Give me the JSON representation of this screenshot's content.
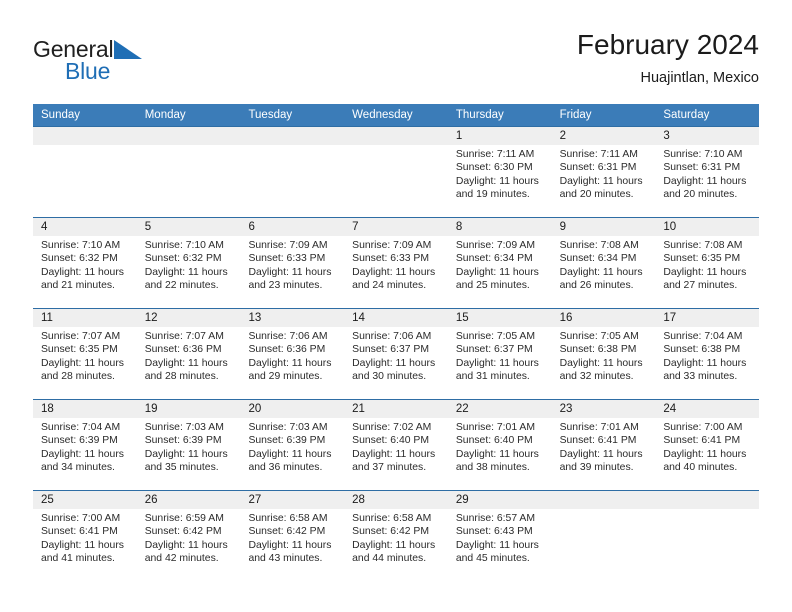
{
  "brand": {
    "name_part1": "General",
    "name_part2": "Blue",
    "logo_icon": "triangle-logo-icon",
    "accent_color": "#1f6eb5"
  },
  "header": {
    "title": "February 2024",
    "subtitle": "Huajintlan, Mexico"
  },
  "calendar": {
    "header_bg": "#3b7cb8",
    "weekdays": [
      "Sunday",
      "Monday",
      "Tuesday",
      "Wednesday",
      "Thursday",
      "Friday",
      "Saturday"
    ],
    "weeks": [
      [
        {
          "day": ""
        },
        {
          "day": ""
        },
        {
          "day": ""
        },
        {
          "day": ""
        },
        {
          "day": "1",
          "sunrise": "Sunrise: 7:11 AM",
          "sunset": "Sunset: 6:30 PM",
          "daylight": "Daylight: 11 hours and 19 minutes."
        },
        {
          "day": "2",
          "sunrise": "Sunrise: 7:11 AM",
          "sunset": "Sunset: 6:31 PM",
          "daylight": "Daylight: 11 hours and 20 minutes."
        },
        {
          "day": "3",
          "sunrise": "Sunrise: 7:10 AM",
          "sunset": "Sunset: 6:31 PM",
          "daylight": "Daylight: 11 hours and 20 minutes."
        }
      ],
      [
        {
          "day": "4",
          "sunrise": "Sunrise: 7:10 AM",
          "sunset": "Sunset: 6:32 PM",
          "daylight": "Daylight: 11 hours and 21 minutes."
        },
        {
          "day": "5",
          "sunrise": "Sunrise: 7:10 AM",
          "sunset": "Sunset: 6:32 PM",
          "daylight": "Daylight: 11 hours and 22 minutes."
        },
        {
          "day": "6",
          "sunrise": "Sunrise: 7:09 AM",
          "sunset": "Sunset: 6:33 PM",
          "daylight": "Daylight: 11 hours and 23 minutes."
        },
        {
          "day": "7",
          "sunrise": "Sunrise: 7:09 AM",
          "sunset": "Sunset: 6:33 PM",
          "daylight": "Daylight: 11 hours and 24 minutes."
        },
        {
          "day": "8",
          "sunrise": "Sunrise: 7:09 AM",
          "sunset": "Sunset: 6:34 PM",
          "daylight": "Daylight: 11 hours and 25 minutes."
        },
        {
          "day": "9",
          "sunrise": "Sunrise: 7:08 AM",
          "sunset": "Sunset: 6:34 PM",
          "daylight": "Daylight: 11 hours and 26 minutes."
        },
        {
          "day": "10",
          "sunrise": "Sunrise: 7:08 AM",
          "sunset": "Sunset: 6:35 PM",
          "daylight": "Daylight: 11 hours and 27 minutes."
        }
      ],
      [
        {
          "day": "11",
          "sunrise": "Sunrise: 7:07 AM",
          "sunset": "Sunset: 6:35 PM",
          "daylight": "Daylight: 11 hours and 28 minutes."
        },
        {
          "day": "12",
          "sunrise": "Sunrise: 7:07 AM",
          "sunset": "Sunset: 6:36 PM",
          "daylight": "Daylight: 11 hours and 28 minutes."
        },
        {
          "day": "13",
          "sunrise": "Sunrise: 7:06 AM",
          "sunset": "Sunset: 6:36 PM",
          "daylight": "Daylight: 11 hours and 29 minutes."
        },
        {
          "day": "14",
          "sunrise": "Sunrise: 7:06 AM",
          "sunset": "Sunset: 6:37 PM",
          "daylight": "Daylight: 11 hours and 30 minutes."
        },
        {
          "day": "15",
          "sunrise": "Sunrise: 7:05 AM",
          "sunset": "Sunset: 6:37 PM",
          "daylight": "Daylight: 11 hours and 31 minutes."
        },
        {
          "day": "16",
          "sunrise": "Sunrise: 7:05 AM",
          "sunset": "Sunset: 6:38 PM",
          "daylight": "Daylight: 11 hours and 32 minutes."
        },
        {
          "day": "17",
          "sunrise": "Sunrise: 7:04 AM",
          "sunset": "Sunset: 6:38 PM",
          "daylight": "Daylight: 11 hours and 33 minutes."
        }
      ],
      [
        {
          "day": "18",
          "sunrise": "Sunrise: 7:04 AM",
          "sunset": "Sunset: 6:39 PM",
          "daylight": "Daylight: 11 hours and 34 minutes."
        },
        {
          "day": "19",
          "sunrise": "Sunrise: 7:03 AM",
          "sunset": "Sunset: 6:39 PM",
          "daylight": "Daylight: 11 hours and 35 minutes."
        },
        {
          "day": "20",
          "sunrise": "Sunrise: 7:03 AM",
          "sunset": "Sunset: 6:39 PM",
          "daylight": "Daylight: 11 hours and 36 minutes."
        },
        {
          "day": "21",
          "sunrise": "Sunrise: 7:02 AM",
          "sunset": "Sunset: 6:40 PM",
          "daylight": "Daylight: 11 hours and 37 minutes."
        },
        {
          "day": "22",
          "sunrise": "Sunrise: 7:01 AM",
          "sunset": "Sunset: 6:40 PM",
          "daylight": "Daylight: 11 hours and 38 minutes."
        },
        {
          "day": "23",
          "sunrise": "Sunrise: 7:01 AM",
          "sunset": "Sunset: 6:41 PM",
          "daylight": "Daylight: 11 hours and 39 minutes."
        },
        {
          "day": "24",
          "sunrise": "Sunrise: 7:00 AM",
          "sunset": "Sunset: 6:41 PM",
          "daylight": "Daylight: 11 hours and 40 minutes."
        }
      ],
      [
        {
          "day": "25",
          "sunrise": "Sunrise: 7:00 AM",
          "sunset": "Sunset: 6:41 PM",
          "daylight": "Daylight: 11 hours and 41 minutes."
        },
        {
          "day": "26",
          "sunrise": "Sunrise: 6:59 AM",
          "sunset": "Sunset: 6:42 PM",
          "daylight": "Daylight: 11 hours and 42 minutes."
        },
        {
          "day": "27",
          "sunrise": "Sunrise: 6:58 AM",
          "sunset": "Sunset: 6:42 PM",
          "daylight": "Daylight: 11 hours and 43 minutes."
        },
        {
          "day": "28",
          "sunrise": "Sunrise: 6:58 AM",
          "sunset": "Sunset: 6:42 PM",
          "daylight": "Daylight: 11 hours and 44 minutes."
        },
        {
          "day": "29",
          "sunrise": "Sunrise: 6:57 AM",
          "sunset": "Sunset: 6:43 PM",
          "daylight": "Daylight: 11 hours and 45 minutes."
        },
        {
          "day": ""
        },
        {
          "day": ""
        }
      ]
    ]
  }
}
